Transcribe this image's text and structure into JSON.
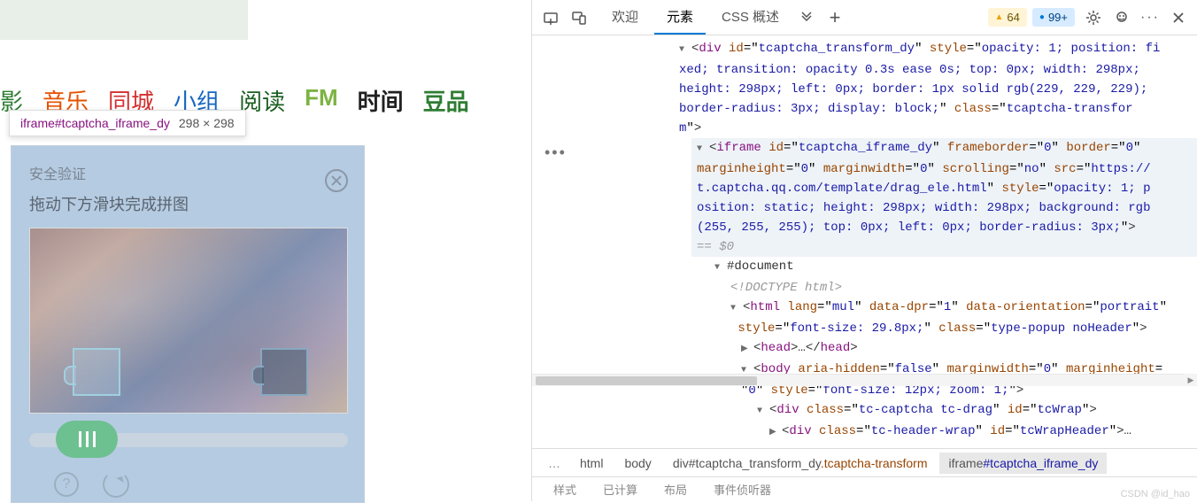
{
  "nav": {
    "items": [
      {
        "label": "影",
        "color": "#2e7d32"
      },
      {
        "label": "音乐",
        "color": "#e65100"
      },
      {
        "label": "同城",
        "color": "#d32f2f"
      },
      {
        "label": "小组",
        "color": "#1565c0"
      },
      {
        "label": "阅读",
        "color": "#1b5e20"
      },
      {
        "label": "FM",
        "color": "#7cb342"
      },
      {
        "label": "时间",
        "color": "#212121"
      },
      {
        "label": "豆品",
        "color": "#2e7d32"
      }
    ]
  },
  "tooltip": {
    "selector": "iframe#tcaptcha_iframe_dy",
    "dims": "298 × 298"
  },
  "captcha": {
    "title": "安全验证",
    "instruction": "拖动下方滑块完成拼图"
  },
  "devtools": {
    "tabs": {
      "welcome": "欢迎",
      "elements": "元素",
      "css": "CSS 概述"
    },
    "badges": {
      "warn": "64",
      "info": "99+",
      "warn_icon": "▲",
      "info_icon": "●"
    },
    "dom": {
      "l1a": "<div id=\"tcaptcha_transform_dy\" style=\"opacity: 1; position: fi",
      "l1b": "xed; transition: opacity 0.3s ease 0s; top: 0px; width: 298px; ",
      "l1c": "height: 298px; left: 0px; border: 1px solid rgb(229, 229, 229); ",
      "l1d": "border-radius: 3px; display: block;\" class=\"tcaptcha-transfor",
      "l1e": "m\">",
      "l2a": "<iframe id=\"tcaptcha_iframe_dy\" frameborder=\"0\" border=\"0\" ",
      "l2b": "marginheight=\"0\" marginwidth=\"0\" scrolling=\"no\" src=\"https://",
      "l2c": "t.captcha.qq.com/template/drag_ele.html\" style=\"opacity: 1; p",
      "l2d": "osition: static; height: 298px; width: 298px; background: rgb",
      "l2e": "(255, 255, 255); top: 0px; left: 0px; border-radius: 3px;\">",
      "l2f": "== $0",
      "l3": "#document",
      "l4": "<!DOCTYPE html>",
      "l5a": "<html lang=\"mul\" data-dpr=\"1\" data-orientation=\"portrait\" ",
      "l5b": "style=\"font-size: 29.8px;\" class=\"type-popup noHeader\">",
      "l6": "<head>…</head>",
      "l7a": "<body aria-hidden=\"false\" marginwidth=\"0\" marginheight=",
      "l7b": "\"0\" style=\"font-size: 12px; zoom: 1;\">",
      "l8": "<div class=\"tc-captcha tc-drag\" id=\"tcWrap\">",
      "l9": "<div class=\"tc-header-wrap\" id=\"tcWrapHeader\">…"
    },
    "breadcrumb": {
      "html": "html",
      "body": "body",
      "div": "div",
      "div_id": "#tcaptcha_transform_dy",
      "div_cls": ".tcaptcha-transform",
      "iframe": "iframe",
      "iframe_id": "#tcaptcha_iframe_dy"
    },
    "bottom": {
      "a": "样式",
      "b": "已计算",
      "c": "布局",
      "d": "事件侦听器"
    }
  },
  "watermark": "CSDN @id_hao"
}
